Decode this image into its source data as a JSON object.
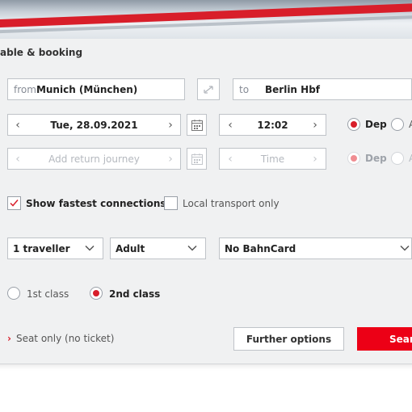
{
  "header": {
    "title": "able & booking"
  },
  "route": {
    "from_prefix": "from",
    "from_value": "Munich (München)",
    "to_prefix": "to",
    "to_value": "Berlin Hbf"
  },
  "outbound": {
    "date": "Tue, 28.09.2021",
    "time": "12:02",
    "dep_label": "Dep",
    "arr_label": "A"
  },
  "return_trip": {
    "date_placeholder": "Add return journey",
    "time_placeholder": "Time",
    "dep_label": "Dep",
    "arr_label": "A"
  },
  "options": {
    "fastest": "Show fastest connections",
    "local": "Local transport only"
  },
  "travellers": {
    "count": "1 traveller",
    "age": "Adult",
    "bahncard": "No BahnCard"
  },
  "travel_class": {
    "first": "1st class",
    "second": "2nd class"
  },
  "footer": {
    "seat_only": "Seat only (no ticket)",
    "further": "Further options",
    "search": "Searc"
  },
  "colors": {
    "accent": "#d81e2a",
    "panel_bg": "#f0f1f2",
    "border": "#bfc3c8"
  }
}
